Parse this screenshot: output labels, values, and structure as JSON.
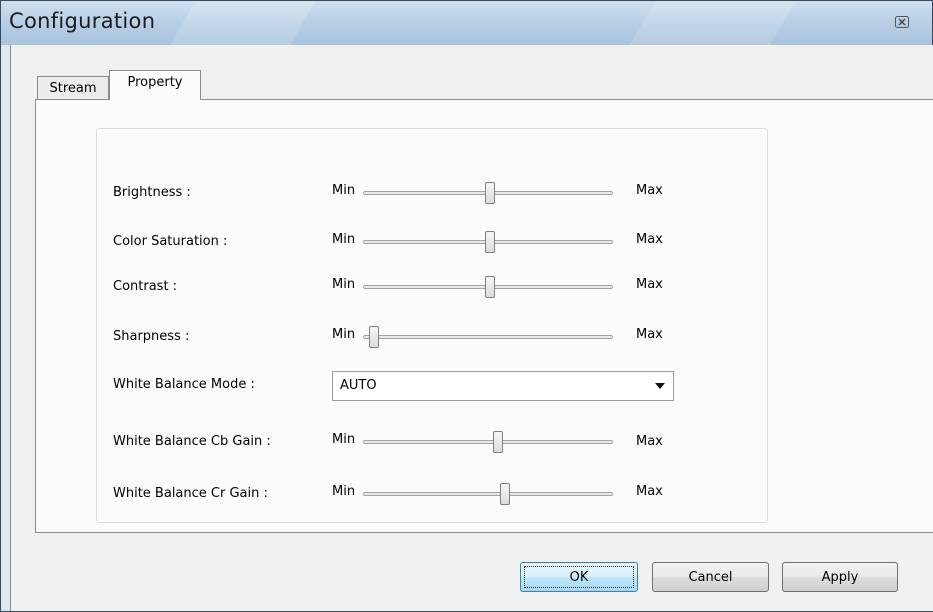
{
  "window": {
    "title": "Configuration",
    "close_icon": "close-icon"
  },
  "tabs": [
    {
      "label": "Stream",
      "selected": false
    },
    {
      "label": "Property",
      "selected": true
    }
  ],
  "properties": {
    "min_label": "Min",
    "max_label": "Max",
    "brightness": {
      "label": "Brightness :",
      "value_fraction": 0.51
    },
    "saturation": {
      "label": "Color Saturation :",
      "value_fraction": 0.51
    },
    "contrast": {
      "label": "Contrast :",
      "value_fraction": 0.51
    },
    "sharpness": {
      "label": "Sharpness :",
      "value_fraction": 0.02
    },
    "wb_mode": {
      "label": "White Balance Mode :",
      "value": "AUTO",
      "arrow_icon": "dropdown-arrow-icon"
    },
    "wb_cb_gain": {
      "label": "White Balance Cb Gain :",
      "value_fraction": 0.54
    },
    "wb_cr_gain": {
      "label": "White Balance Cr Gain :",
      "value_fraction": 0.57
    }
  },
  "buttons": {
    "ok": "OK",
    "cancel": "Cancel",
    "apply": "Apply"
  },
  "colors": {
    "titlebar": "#b9d0e6",
    "client": "#f0f0f0",
    "ok_accent": "#3c7fb1"
  }
}
